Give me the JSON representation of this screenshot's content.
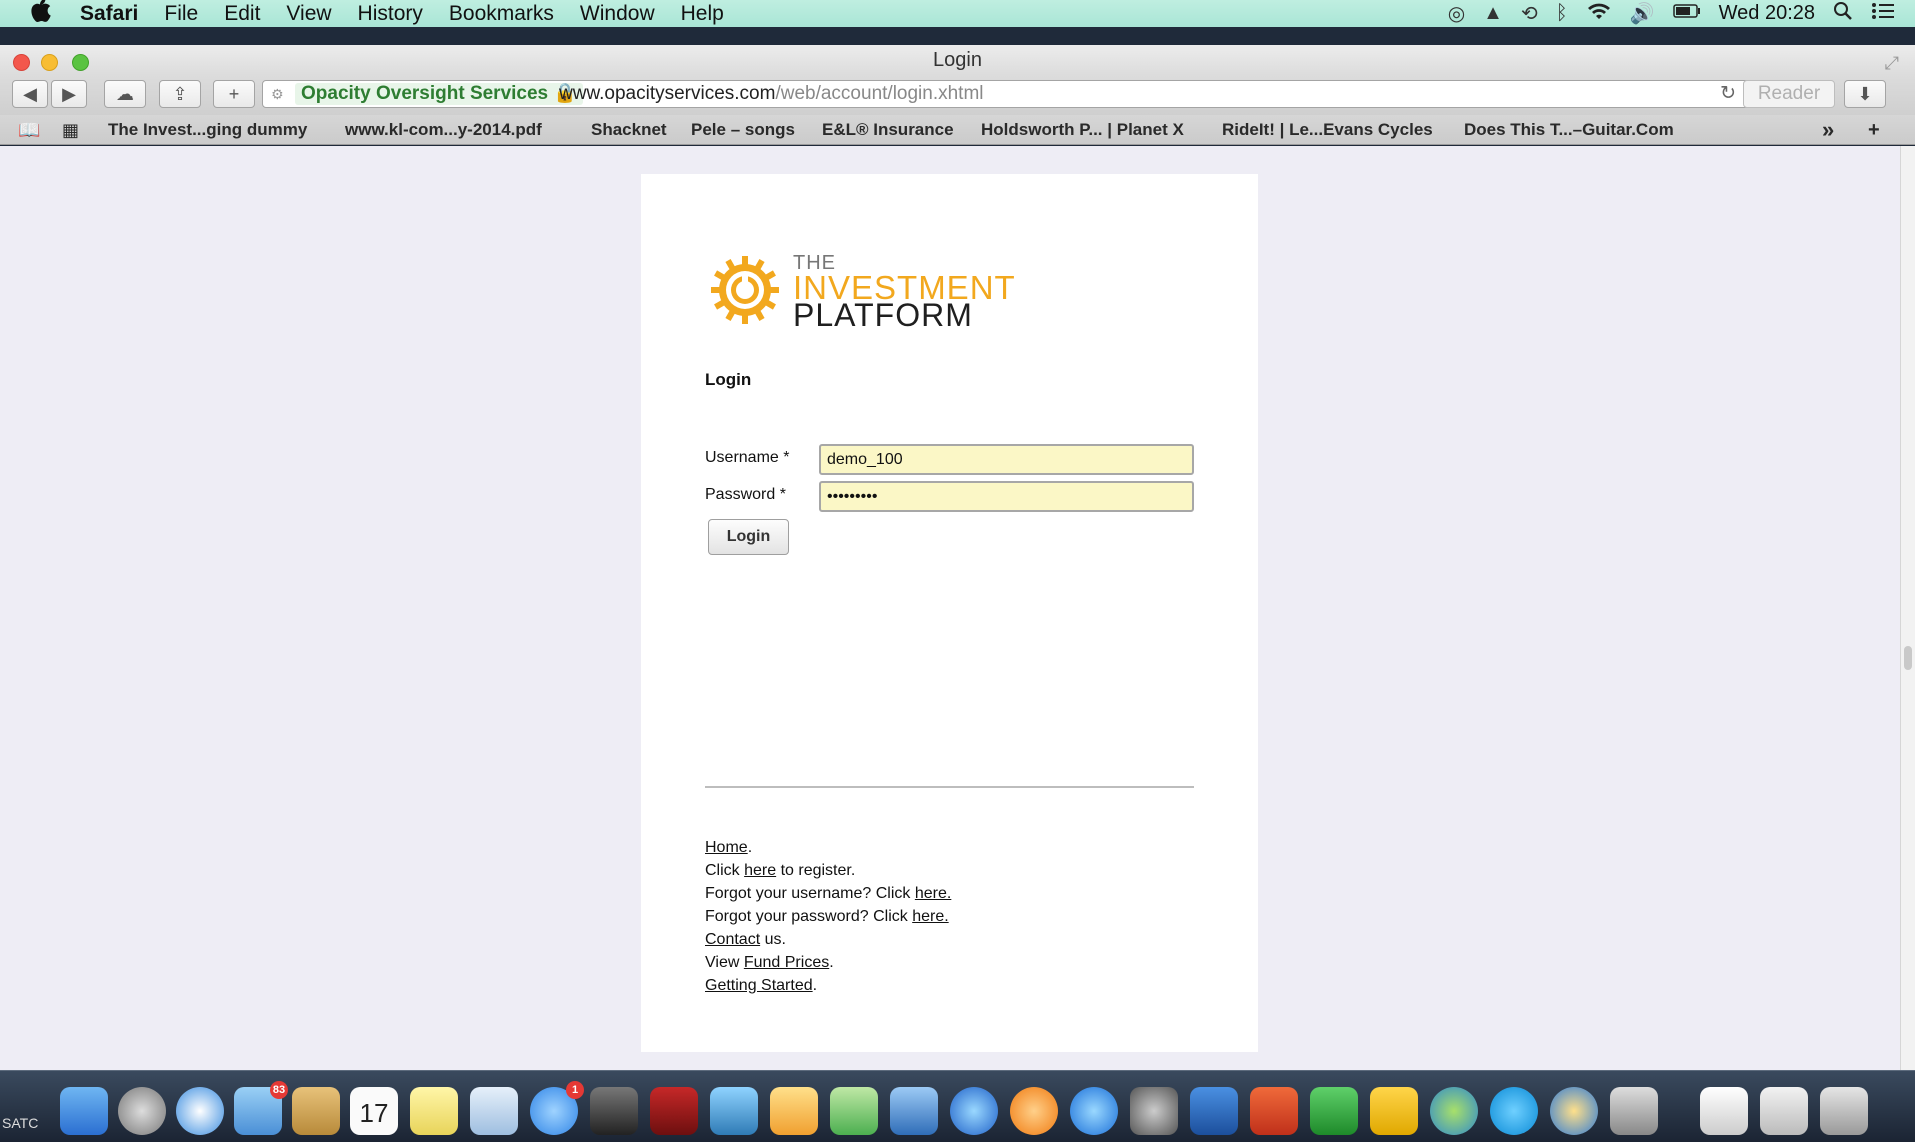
{
  "menubar": {
    "apple": "",
    "app": "Safari",
    "items": [
      "File",
      "Edit",
      "View",
      "History",
      "Bookmarks",
      "Window",
      "Help"
    ],
    "clock": "Wed 20:28"
  },
  "window": {
    "title": "Login"
  },
  "toolbar": {
    "back": "◀",
    "forward": "▶",
    "cloud": "☁",
    "share": "⇪",
    "new_tab": "+",
    "cert_name": "Opacity Oversight Services",
    "url_domain": "www.opacityservices.com",
    "url_path": "/web/account/login.xhtml",
    "reload": "↻",
    "reader": "Reader"
  },
  "bookmarks": {
    "items": [
      "The Invest...ging dummy",
      "www.kl-com...y-2014.pdf",
      "Shacknet",
      "Pele – songs",
      "E&L® Insurance",
      "Holdsworth P... | Planet X",
      "RideIt! | Le...Evans Cycles",
      "Does This T...–Guitar.Com"
    ],
    "more": "»"
  },
  "logo": {
    "line1": "THE",
    "line2": "INVESTMENT",
    "line3": "PLATFORM"
  },
  "form": {
    "heading": "Login",
    "username_label": "Username *",
    "username_value": "demo_100",
    "password_label": "Password *",
    "password_value": "•••••••••",
    "login_button": "Login"
  },
  "links": {
    "home": "Home",
    "register_pre": "Click ",
    "register_link": "here",
    "register_post": " to register.",
    "forgot_user_pre": "Forgot your username? Click ",
    "forgot_user_link": "here.",
    "forgot_pass_pre": "Forgot your password? Click ",
    "forgot_pass_link": "here.",
    "contact_link": "Contact",
    "contact_post": " us.",
    "fund_pre": "View ",
    "fund_link": "Fund Prices",
    "getting_started": "Getting Started"
  },
  "dock": {
    "satc_label": "SATC",
    "mail_badge": "83",
    "messages_badge": "1",
    "calendar_day": "17"
  },
  "colors": {
    "logo_orange": "#f2a81e",
    "input_bg": "#fbf7c6",
    "page_bg": "#eeedf5"
  }
}
